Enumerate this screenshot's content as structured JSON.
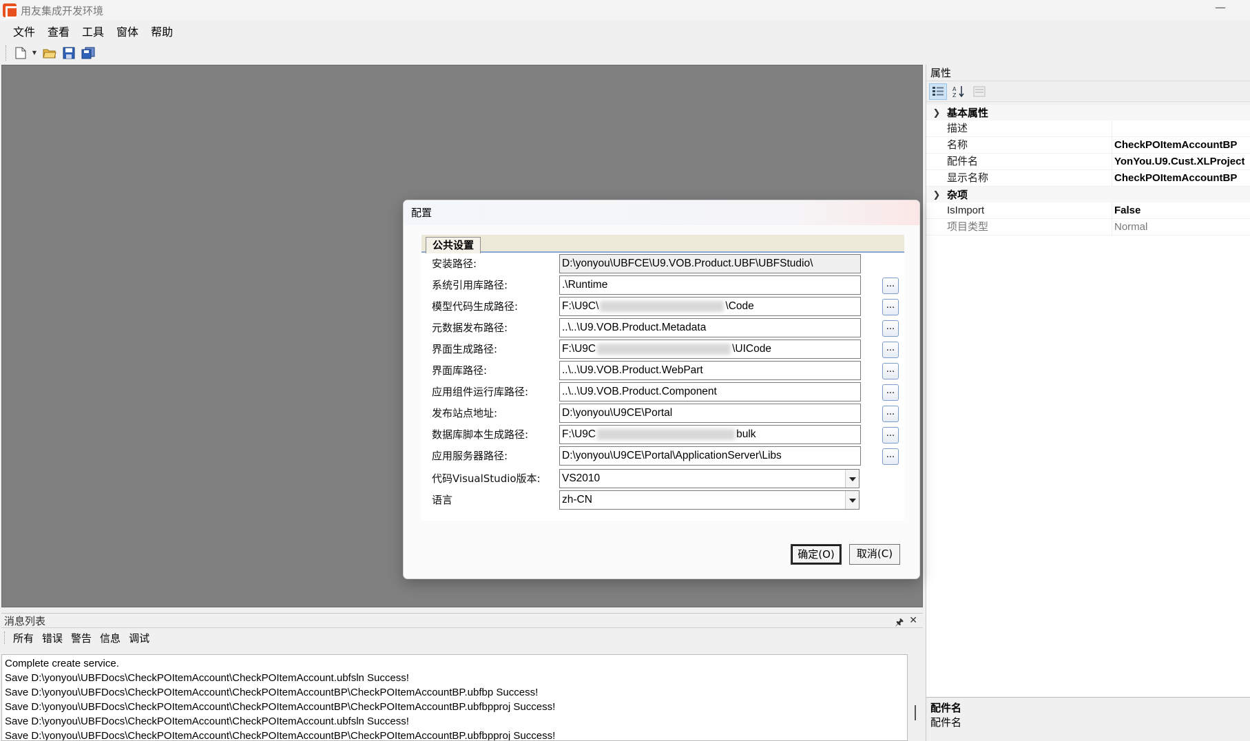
{
  "window": {
    "title": "用友集成开发环境",
    "minimize_glyph": "—"
  },
  "menu": [
    "文件",
    "查看",
    "工具",
    "窗体",
    "帮助"
  ],
  "toolbar": {
    "icons": [
      "new-file-icon",
      "open-folder-icon",
      "save-icon",
      "save-all-icon"
    ]
  },
  "dialog": {
    "title": "配置",
    "tab": "公共设置",
    "fields": [
      {
        "label": "安装路径:",
        "value": "D:\\yonyou\\UBFCE\\U9.VOB.Product.UBF\\UBFStudio\\",
        "readonly": true
      },
      {
        "label": "系统引用库路径:",
        "value": ".\\Runtime",
        "browse": true
      },
      {
        "label": "模型代码生成路径:",
        "prefix": "F:\\U9C\\",
        "suffix": "\\Code",
        "browse": true
      },
      {
        "label": "元数据发布路径:",
        "value": "..\\..\\U9.VOB.Product.Metadata",
        "browse": true
      },
      {
        "label": "界面生成路径:",
        "prefix": "F:\\U9C",
        "suffix": "\\UICode",
        "browse": true
      },
      {
        "label": "界面库路径:",
        "value": "..\\..\\U9.VOB.Product.WebPart",
        "browse": true
      },
      {
        "label": "应用组件运行库路径:",
        "value": "..\\..\\U9.VOB.Product.Component",
        "browse": true
      },
      {
        "label": "发布站点地址:",
        "value": "D:\\yonyou\\U9CE\\Portal",
        "browse": true
      },
      {
        "label": "数据库脚本生成路径:",
        "prefix": "F:\\U9C",
        "suffix": "bulk",
        "browse": true
      },
      {
        "label": "应用服务器路径:",
        "value": "D:\\yonyou\\U9CE\\Portal\\ApplicationServer\\Libs",
        "browse": true
      }
    ],
    "browse_label": "...",
    "vs_version": {
      "label": "代码VisualStudio版本:",
      "value": "VS2010"
    },
    "language": {
      "label": "语言",
      "value": "zh-CN"
    },
    "ok_label": "确定(O)",
    "cancel_label": "取消(C)"
  },
  "messages": {
    "title": "消息列表",
    "pin_glyph": "🖈",
    "close_glyph": "✕",
    "tabs": [
      "所有",
      "错误",
      "警告",
      "信息",
      "调试"
    ],
    "lines": [
      "Complete create service.",
      "Save D:\\yonyou\\UBFDocs\\CheckPOItemAccount\\CheckPOItemAccount.ubfsln Success!",
      "Save D:\\yonyou\\UBFDocs\\CheckPOItemAccount\\CheckPOItemAccountBP\\CheckPOItemAccountBP.ubfbp Success!",
      "Save D:\\yonyou\\UBFDocs\\CheckPOItemAccount\\CheckPOItemAccountBP\\CheckPOItemAccountBP.ubfbpproj Success!",
      "Save D:\\yonyou\\UBFDocs\\CheckPOItemAccount\\CheckPOItemAccount.ubfsln Success!",
      "Save D:\\yonyou\\UBFDocs\\CheckPOItemAccount\\CheckPOItemAccountBP\\CheckPOItemAccountBP.ubfbpproj Success!"
    ]
  },
  "properties": {
    "title": "属性",
    "categories": [
      {
        "name": "基本属性",
        "rows": [
          {
            "name": "描述",
            "value": ""
          },
          {
            "name": "名称",
            "value": "CheckPOItemAccountBP"
          },
          {
            "name": "配件名",
            "value": "YonYou.U9.Cust.XLProject"
          },
          {
            "name": "显示名称",
            "value": "CheckPOItemAccountBP"
          }
        ]
      },
      {
        "name": "杂项",
        "rows": [
          {
            "name": "IsImport",
            "value": "False"
          },
          {
            "name": "项目类型",
            "value": "Normal",
            "dim": true
          }
        ]
      }
    ],
    "desc_title": "配件名",
    "desc_text": "配件名"
  }
}
